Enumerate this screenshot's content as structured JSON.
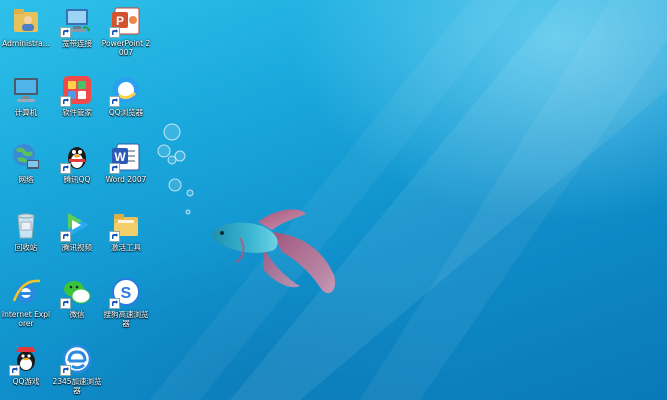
{
  "desktop": {
    "icons": [
      {
        "label": "Administra..."
      },
      {
        "label": "宽带连接"
      },
      {
        "label": "PowerPoint 2007"
      },
      {
        "label": "计算机"
      },
      {
        "label": "软件管家"
      },
      {
        "label": "QQ浏览器"
      },
      {
        "label": "网络"
      },
      {
        "label": "腾讯QQ"
      },
      {
        "label": "Word 2007"
      },
      {
        "label": "回收站"
      },
      {
        "label": "腾讯视频"
      },
      {
        "label": "激活工具"
      },
      {
        "label": "Internet Explorer"
      },
      {
        "label": "微信"
      },
      {
        "label": "搜狗高速浏览器"
      },
      {
        "label": "QQ游戏"
      },
      {
        "label": "2345加速浏览器"
      }
    ],
    "colors": {
      "wallpaper_top": "#2fc1ea",
      "wallpaper_bottom": "#0a78b8"
    }
  }
}
